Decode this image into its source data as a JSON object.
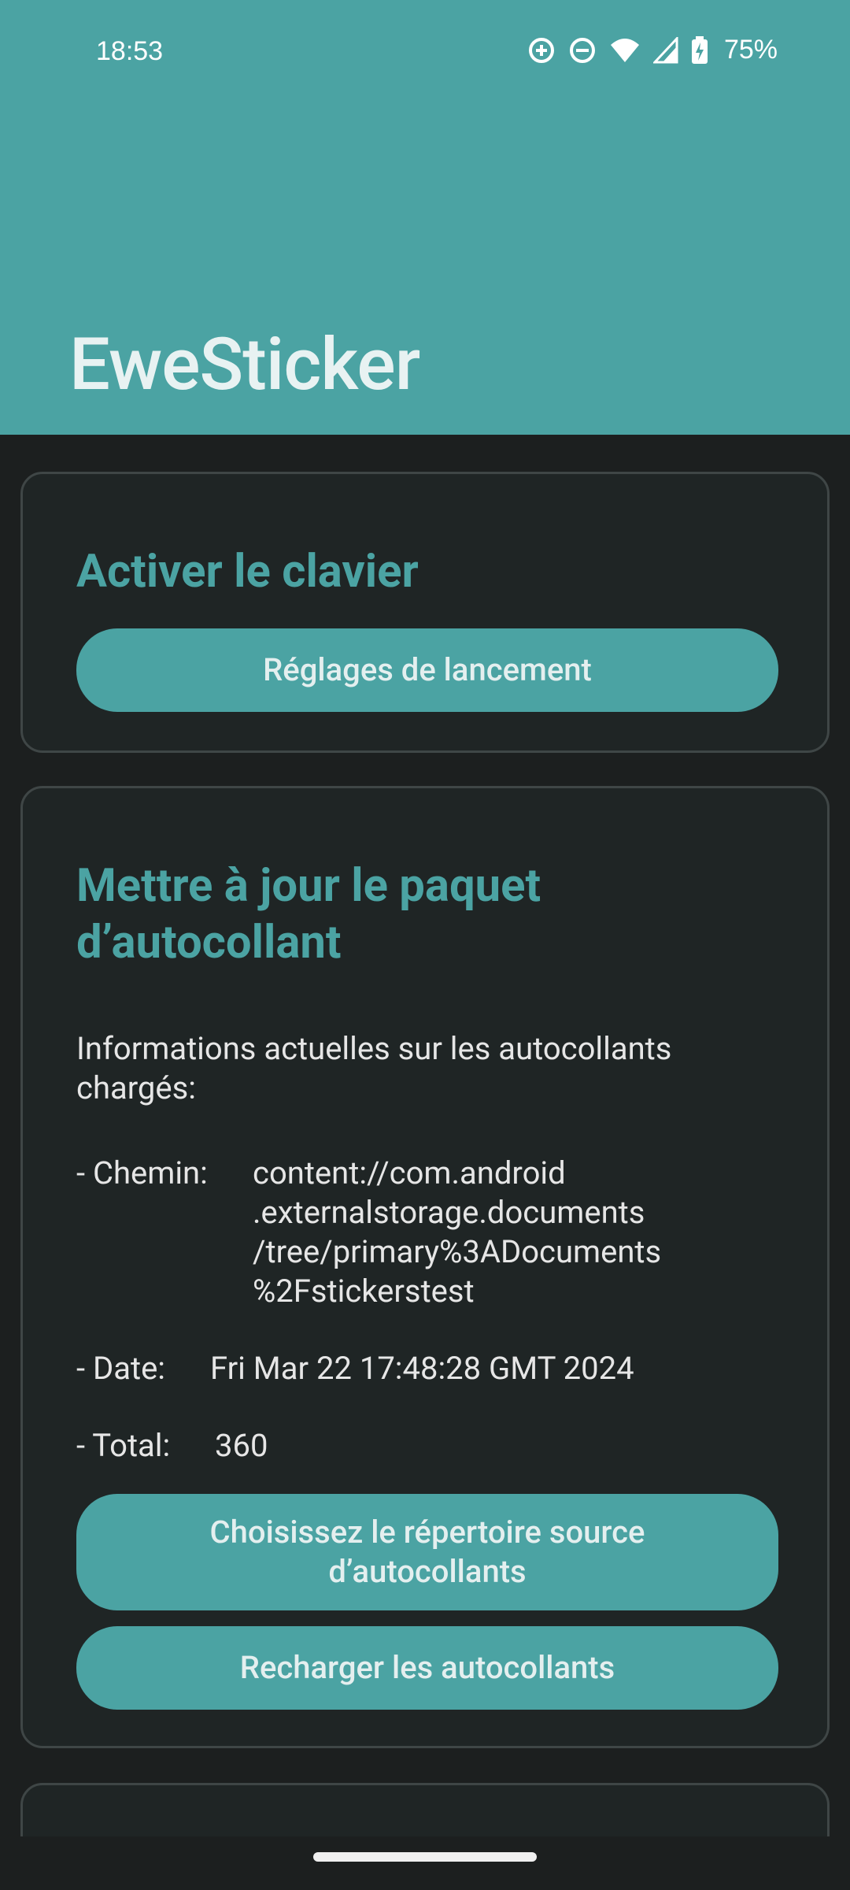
{
  "status": {
    "time": "18:53",
    "battery": "75%",
    "icons": [
      "data-saver-icon",
      "do-not-disturb-icon",
      "wifi-icon",
      "cellular-signal-icon",
      "battery-charging-icon"
    ]
  },
  "app": {
    "title": "EweSticker"
  },
  "cards": {
    "keyboard": {
      "title": "Activer le clavier",
      "button_label": "Réglages de lancement"
    },
    "update": {
      "title": "Mettre à jour le paquet d’autocollant",
      "intro": "Informations actuelles sur les autocollants chargés:",
      "path_label": "- Chemin:",
      "path_value": "content://com.android\n.externalstorage.documents\n/tree/primary%3ADocuments\n%2Fstickerstest",
      "date_label": "- Date:",
      "date_value": "Fri Mar 22 17:48:28 GMT 2024",
      "total_label": "- Total:",
      "total_value": "360",
      "choose_button_label": "Choisissez le répertoire source d’autocollants",
      "reload_button_label": "Recharger les autocollants"
    }
  },
  "colors": {
    "accent": "#4ba3a3",
    "background": "#1c1f1f",
    "card": "#1f2525"
  }
}
